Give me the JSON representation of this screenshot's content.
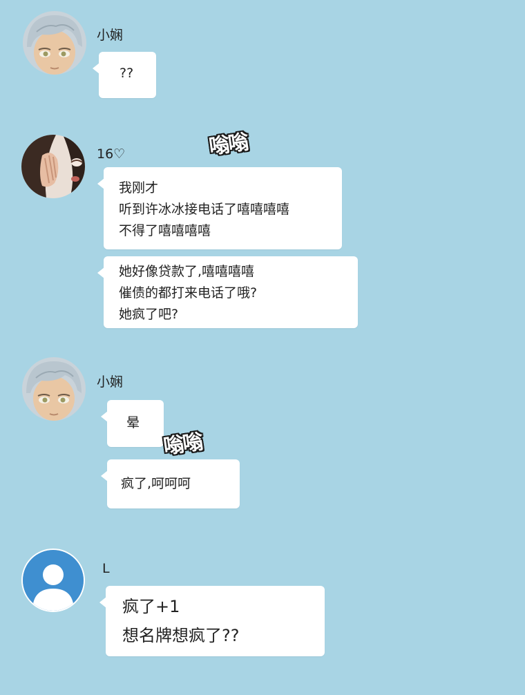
{
  "messages": [
    {
      "sender": "小娴",
      "avatar_icon": "silver-hair-girl-avatar",
      "bubbles": [
        {
          "lines": [
            "??"
          ]
        }
      ]
    },
    {
      "sender": "16♡",
      "avatar_icon": "dark-hair-hand-covering-face-avatar",
      "bubbles": [
        {
          "lines": [
            "我刚才",
            "听到许冰冰接电话了嘻嘻嘻嘻",
            "不得了嘻嘻嘻嘻"
          ]
        },
        {
          "lines": [
            "她好像贷款了,嘻嘻嘻嘻",
            "催债的都打来电话了哦?",
            "她疯了吧?"
          ]
        }
      ]
    },
    {
      "sender": "小娴",
      "avatar_icon": "silver-hair-girl-avatar",
      "bubbles": [
        {
          "lines": [
            "晕"
          ]
        },
        {
          "lines": [
            "疯了,呵呵呵"
          ]
        }
      ]
    },
    {
      "sender": "L",
      "avatar_icon": "default-user-silhouette-avatar",
      "bubbles": [
        {
          "lines": [
            "疯了+1",
            "想名牌想疯了??"
          ]
        }
      ]
    }
  ],
  "sound_effects": [
    "嗡嗡",
    "嗡嗡"
  ],
  "colors": {
    "background": "#a8d4e4",
    "bubble": "#ffffff",
    "text": "#222222"
  }
}
